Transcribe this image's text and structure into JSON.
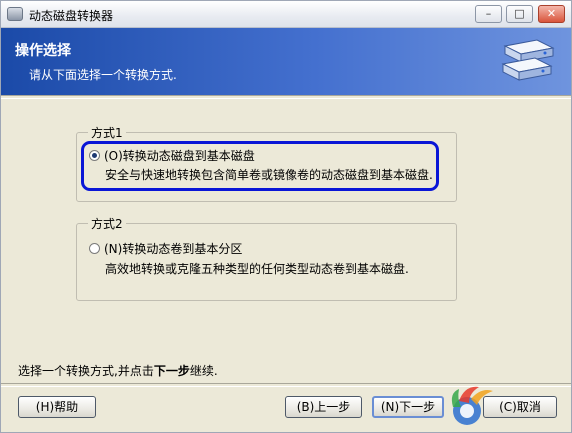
{
  "window": {
    "title": "动态磁盘转换器",
    "controls": {
      "minimize": "–",
      "maximize": "□",
      "close": "✕"
    }
  },
  "header": {
    "title": "操作选择",
    "subtitle": "请从下面选择一个转换方式.",
    "icon": "disk-stack-icon"
  },
  "options": [
    {
      "group_label": "方式1",
      "label": "(O)转换动态磁盘到基本磁盘",
      "description": "安全与快速地转换包含简单卷或镜像卷的动态磁盘到基本磁盘.",
      "checked": true
    },
    {
      "group_label": "方式2",
      "label": "(N)转换动态卷到基本分区",
      "description": "高效地转换或克隆五种类型的任何类型动态卷到基本磁盘.",
      "checked": false
    }
  ],
  "status": {
    "prefix": "选择一个转换方式,并点击",
    "emphasis": "下一步",
    "suffix": "继续."
  },
  "buttons": {
    "help": "(H)帮助",
    "back": "(B)上一步",
    "next": "(N)下一步",
    "cancel": "(C)取消"
  },
  "colors": {
    "header_start": "#1b4aa8",
    "header_end": "#6f94de",
    "focus_ring": "#0a16d6",
    "window_bg": "#ece9d8"
  }
}
